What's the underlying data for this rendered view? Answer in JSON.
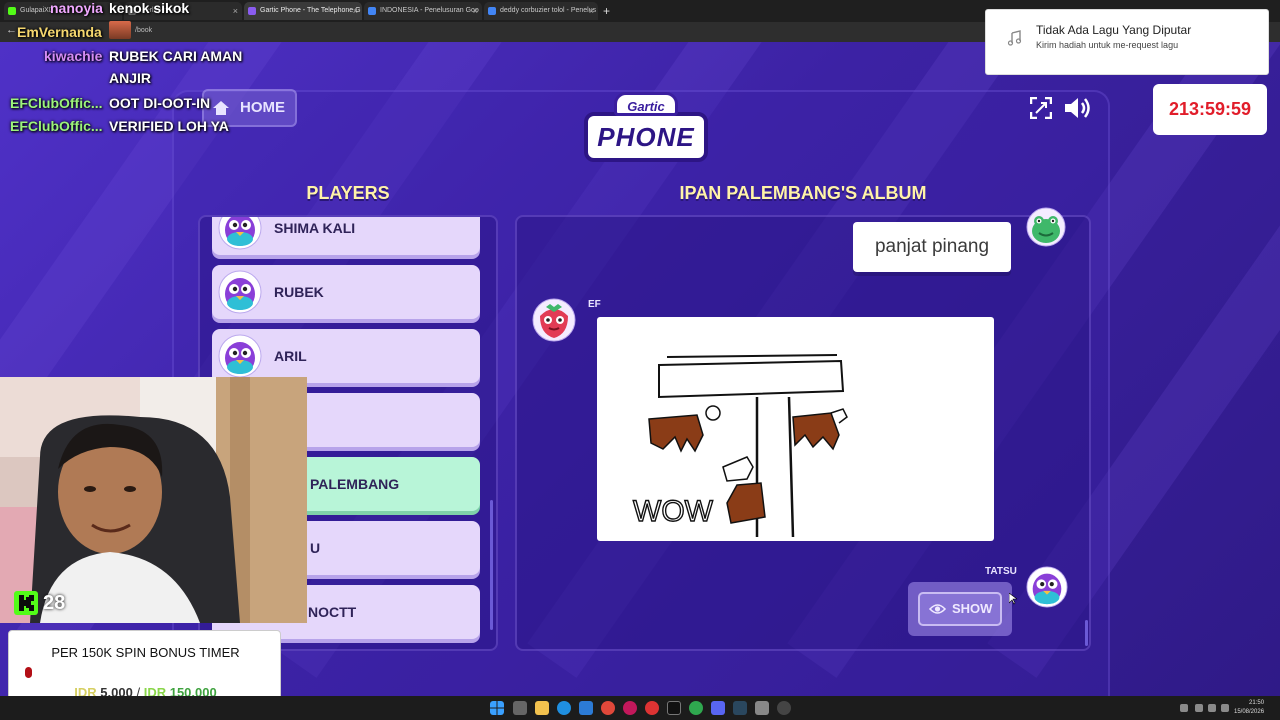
{
  "browser": {
    "tabs": [
      {
        "title": "GulapaiXD"
      },
      {
        "title": "...erlay-mu - G"
      },
      {
        "title": "Gartic Phone - The Telephone G"
      },
      {
        "title": "INDONESIA - Penelusuran Goo"
      },
      {
        "title": "deddy corbuzier tolol - Penelus"
      }
    ],
    "new_tab": "+",
    "url": "/book"
  },
  "game": {
    "home_label": "HOME",
    "logo_top": "Gartic",
    "logo_main": "PHONE",
    "players_title": "PLAYERS",
    "album_title": "IPAN PALEMBANG'S ALBUM",
    "players": [
      {
        "name": "SHIMA KALI",
        "highlight": false
      },
      {
        "name": "RUBEK",
        "highlight": false
      },
      {
        "name": "ARIL",
        "highlight": false
      },
      {
        "name": "",
        "highlight": false
      },
      {
        "name": "PALEMBANG",
        "highlight": true
      },
      {
        "name": "U",
        "highlight": false
      },
      {
        "name": "NOCTT",
        "highlight": false
      }
    ],
    "bubble_text": "panjat pinang",
    "drawing_author": "EF",
    "drawing_text": "WOW",
    "next_author": "TATSU",
    "show_label": "SHOW"
  },
  "chat": [
    {
      "user": "nanoyia",
      "message": "kenok sikok",
      "user_color": "#f0a8ff"
    },
    {
      "user": "EmVernanda",
      "message": "",
      "user_color": "#f5d76e"
    },
    {
      "user": "kiwachie",
      "message": "RUBEK CARI AMAN",
      "user_color": "#d58cf5"
    },
    {
      "user": "",
      "message": "ANJIR",
      "user_color": "#ffffff"
    },
    {
      "user": "EFClubOffic...",
      "message": "OOT DI-OOT-IN",
      "user_color": "#9cf57a"
    },
    {
      "user": "EFClubOffic...",
      "message": "VERIFIED LOH YA",
      "user_color": "#9cf57a"
    }
  ],
  "notification": {
    "title": "Tidak Ada Lagu Yang Diputar",
    "subtitle": "Kirim hadiah untuk me-request lagu",
    "icon": "music-note-icon"
  },
  "timer": "213:59:59",
  "viewers": "28",
  "donation": {
    "title": "PER 150K SPIN BONUS TIMER",
    "currency": "IDR",
    "current": "5.000",
    "separator": "/",
    "target": "150.000"
  },
  "taskbar": {
    "time": "21:50",
    "date": "15/08/2026"
  },
  "colors": {
    "accent_title": "#fff3a8",
    "timer_red": "#e11d2a",
    "player_card": "#e5d7fb",
    "player_highlight": "#b8f5d8"
  }
}
